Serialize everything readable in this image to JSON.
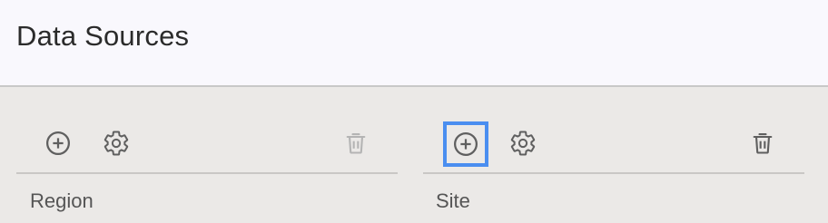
{
  "header": {
    "title": "Data Sources"
  },
  "panels": [
    {
      "label": "Region",
      "buttons": {
        "add": {
          "icon": "add-circle-icon",
          "enabled": true
        },
        "settings": {
          "icon": "gear-icon",
          "enabled": true
        },
        "delete": {
          "icon": "trash-icon",
          "enabled": false
        }
      }
    },
    {
      "label": "Site",
      "buttons": {
        "add": {
          "icon": "add-circle-icon",
          "enabled": true,
          "focused": true
        },
        "settings": {
          "icon": "gear-icon",
          "enabled": true
        },
        "delete": {
          "icon": "trash-icon",
          "enabled": true
        }
      }
    }
  ],
  "colors": {
    "focus_ring": "#4a8ef0",
    "icon_enabled": "#5f5f5f",
    "icon_disabled": "#b4b4b4",
    "header_bg": "#f9f8fd",
    "body_bg": "#ebe9e7"
  }
}
